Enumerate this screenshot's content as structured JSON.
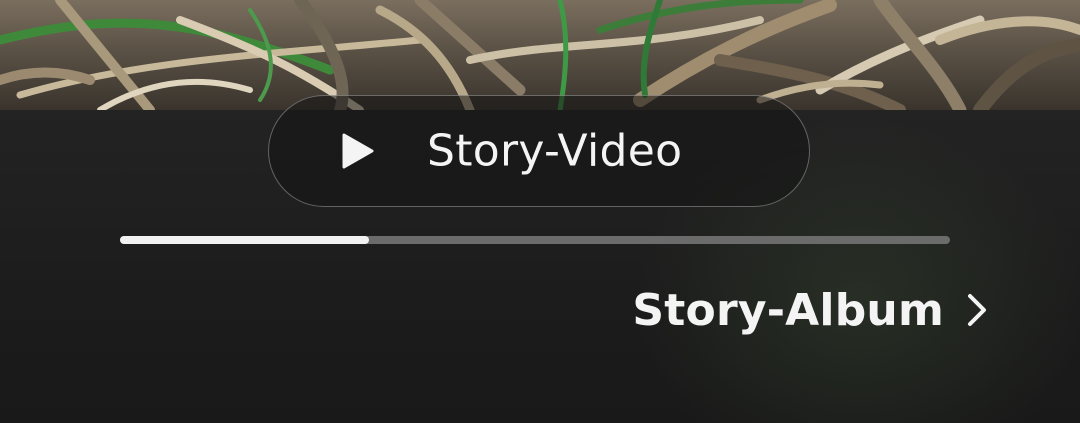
{
  "story_video": {
    "label": "Story-Video",
    "icon": "play-icon"
  },
  "progress": {
    "fraction": 0.3
  },
  "story_album": {
    "label": "Story-Album",
    "icon": "chevron-right-icon"
  },
  "colors": {
    "text": "#f4f4f4",
    "panel": "#1c1c1c",
    "track": "#6b6b6b",
    "fill": "#f2f2f2"
  }
}
